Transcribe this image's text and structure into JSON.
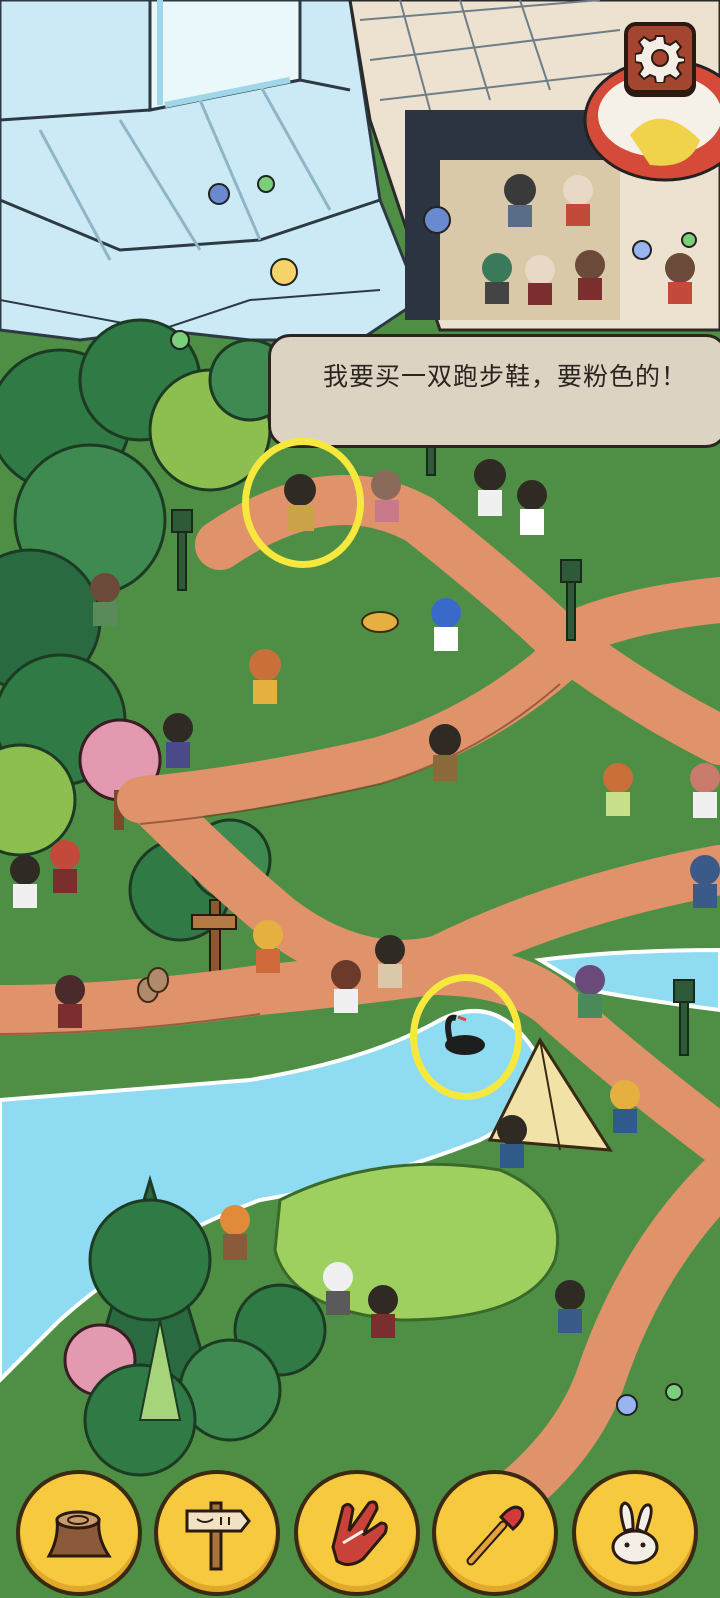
{
  "dialog": {
    "text": "我要买一双跑步鞋，要粉色的！"
  },
  "settings": {
    "icon": "gear-icon"
  },
  "found_markers": [
    {
      "name": "found-marker-bench-person"
    },
    {
      "name": "found-marker-black-swan"
    }
  ],
  "toolbar": {
    "items": [
      {
        "icon": "tree-stump-icon"
      },
      {
        "icon": "wooden-signpost-icon"
      },
      {
        "icon": "red-glove-icon"
      },
      {
        "icon": "paintbrush-icon"
      },
      {
        "icon": "rabbit-icon"
      }
    ]
  },
  "colors": {
    "grass": "#4f8f45",
    "path": "#e0936a",
    "water": "#8fdcf2",
    "highlight": "#f7e83e",
    "button": "#f6c93e",
    "dialog_bg": "#ddd3c3"
  }
}
